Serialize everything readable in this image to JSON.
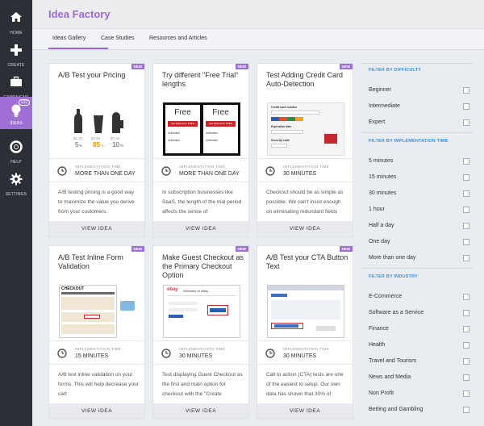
{
  "nav": {
    "home": "HOME",
    "create": "CREATE",
    "campaigns": "CAMPAIGNS",
    "ideas": "IDEAS",
    "ideas_badge": "132",
    "help": "HELP",
    "settings": "SETTINGS"
  },
  "header": {
    "title": "Idea Factory"
  },
  "tabs": [
    "Ideas Gallery",
    "Case Studies",
    "Resources and Articles"
  ],
  "cards": [
    {
      "badge": "NEW",
      "title": "A/B Test your Pricing",
      "impl_label": "IMPLEMENTATION TIME",
      "impl_value": "MORE THAN ONE DAY",
      "desc": "A/B testing pricing is a good way to maximize the value you derive from your customers.",
      "button": "VIEW IDEA",
      "prices": [
        {
          "old": "$1.80",
          "new": "5"
        },
        {
          "old": "$2.50",
          "new": "85"
        },
        {
          "old": "$3.40",
          "new": "10"
        }
      ]
    },
    {
      "badge": "NEW",
      "title": "Try different \"Free Trial\" lengths",
      "impl_label": "IMPLEMENTATION TIME",
      "impl_value": "MORE THAN ONE DAY",
      "desc": "In subscription businesses like SaaS, the length of the trial period affects the sense of",
      "button": "VIEW IDEA",
      "thumb_free": "Free",
      "thumb_cta": "Get Started for FREE",
      "thumb_unlimited": "Unlimited"
    },
    {
      "badge": "NEW",
      "title": "Test Adding Credit Card Auto-Detection",
      "impl_label": "IMPLEMENTATION TIME",
      "impl_value": "30 MINUTES",
      "desc": "Checkout should be as simple as possible. We can't insist enough on eliminating redundant fields",
      "button": "VIEW IDEA",
      "thumb_labels": [
        "Credit card number",
        "Expiration date",
        "Security code"
      ]
    },
    {
      "badge": "NEW",
      "title": "A/B Test Inline Form Validation",
      "impl_label": "IMPLEMENTATION TIME",
      "impl_value": "15 MINUTES",
      "desc": "A/B test inline validation on your forms. This will help decrease your cart",
      "button": "VIEW IDEA",
      "thumb_heading": "CHECKOUT"
    },
    {
      "badge": "NEW",
      "title": "Make Guest Checkout as the Primary Checkout Option",
      "impl_label": "IMPLEMENTATION TIME",
      "impl_value": "30 MINUTES",
      "desc": "Test displaying Guest Checkout as the first and main option for checkout with the \"Create",
      "button": "VIEW IDEA",
      "thumb_logo": "ebay",
      "thumb_welcome": "Welcome to eBay"
    },
    {
      "badge": "NEW",
      "title": "A/B Test your CTA Button Text",
      "impl_label": "IMPLEMENTATION TIME",
      "impl_value": "30 MINUTES",
      "desc": "Call to action (CTA) tests are one of the easiest to setup. Our own data has shown that 30% of",
      "button": "VIEW IDEA"
    }
  ],
  "filters": {
    "difficulty": {
      "heading": "FILTER BY DIFFICULTY",
      "items": [
        "Beginner",
        "Intermediate",
        "Expert"
      ]
    },
    "time": {
      "heading": "FILTER BY IMPLEMENTATION TIME",
      "items": [
        "5 minutes",
        "15 minutes",
        "30 minutes",
        "1 hour",
        "Half a day",
        "One day",
        "More than one day"
      ]
    },
    "industry": {
      "heading": "FILTER BY INDUSTRY",
      "items": [
        "E-Commerce",
        "Software as a Service",
        "Finance",
        "Health",
        "Travel and Tourism",
        "News and Media",
        "Non Profit",
        "Betting and Gambling"
      ]
    }
  },
  "colors": {
    "accent": "#9b68d4",
    "sidebar": "#2d2f36",
    "filter_heading": "#3b8edf"
  }
}
